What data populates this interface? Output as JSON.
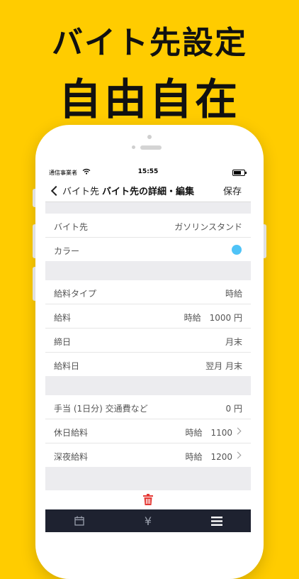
{
  "promo": {
    "headline_line1": "バイト先設定",
    "headline_line2": "自由自在"
  },
  "status_bar": {
    "carrier": "通信事業者",
    "time": "15:55"
  },
  "nav": {
    "back_label": "バイト先",
    "title": "バイト先の詳細・編集",
    "save_label": "保存"
  },
  "sections": {
    "basic": {
      "workplace_label": "バイト先",
      "workplace_value": "ガソリンスタンド",
      "color_label": "カラー",
      "color_value": "#4FC3F7"
    },
    "pay": {
      "pay_type_label": "給料タイプ",
      "pay_type_value": "時給",
      "salary_label": "給料",
      "salary_value": "時給　1000 円",
      "closing_label": "締日",
      "closing_value": "月末",
      "payday_label": "給料日",
      "payday_value": "翌月 月末"
    },
    "extras": {
      "allowance_label": "手当 (1日分) 交通費など",
      "allowance_value": "0 円",
      "holiday_label": "休日給料",
      "holiday_value": "時給　1100",
      "night_label": "深夜給料",
      "night_value": "時給　1200"
    }
  },
  "tabbar": {
    "items": [
      "calendar-icon",
      "yen-icon",
      "menu-icon"
    ],
    "yen_glyph": "¥"
  },
  "colors": {
    "background": "#FFCC00",
    "tabbar": "#1e2230",
    "trash": "#E53935",
    "color_dot": "#4FC3F7"
  }
}
